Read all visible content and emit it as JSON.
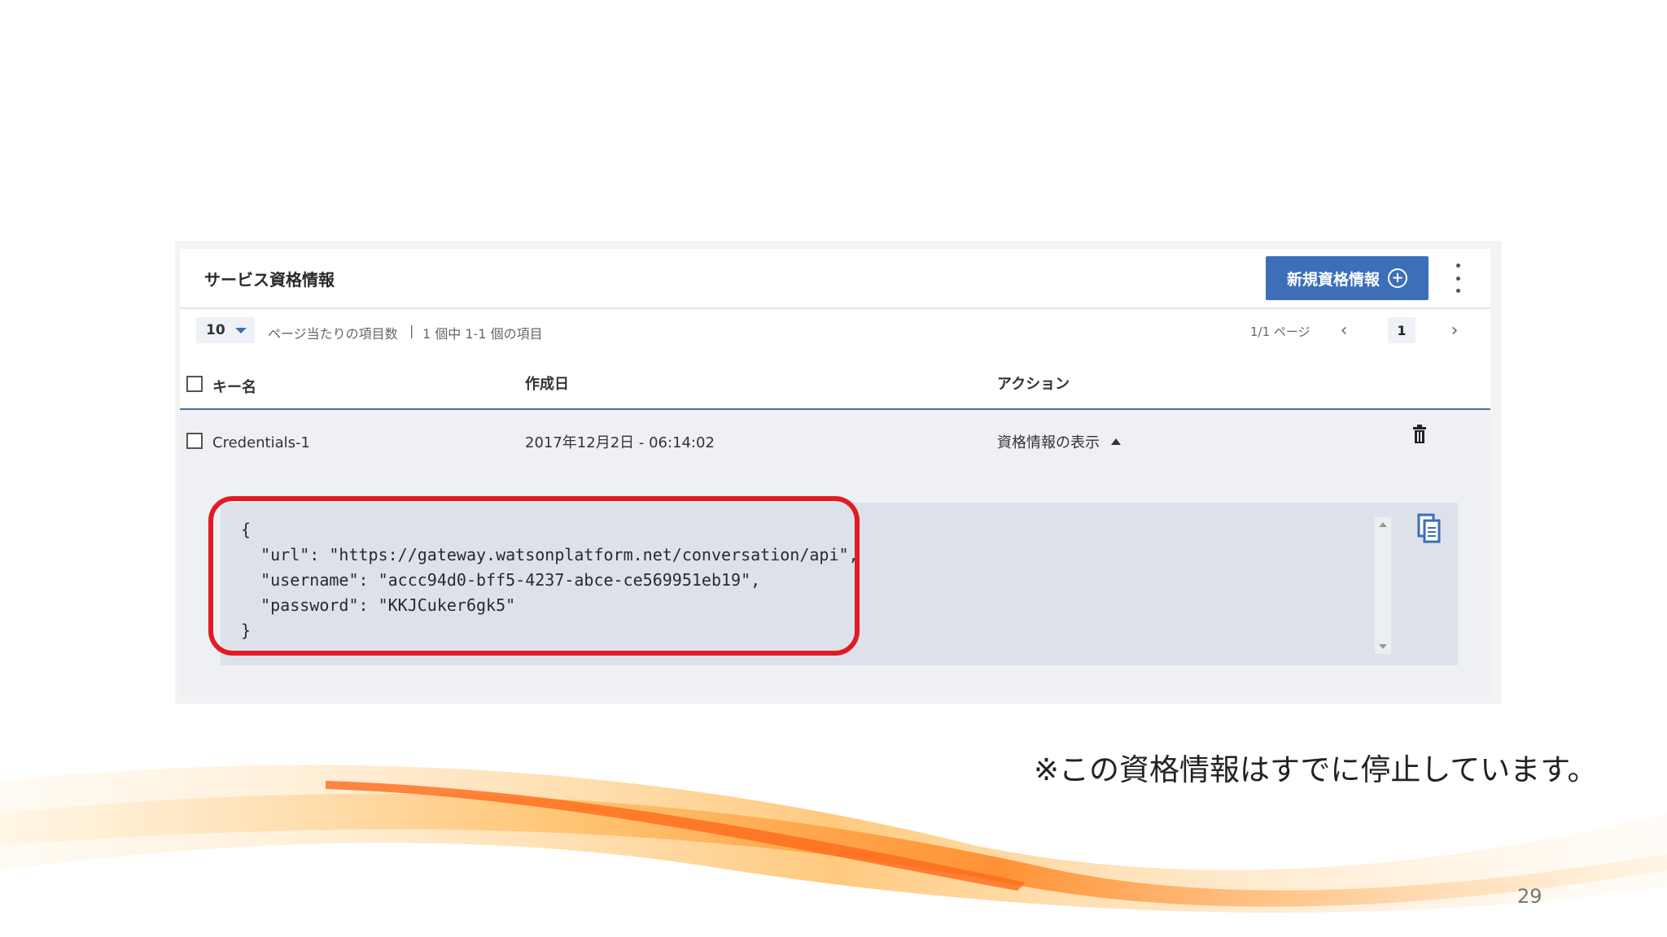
{
  "panel": {
    "title": "サービス資格情報",
    "new_button_label": "新規資格情報"
  },
  "pager": {
    "per_page": "10",
    "per_page_label": "ページ当たりの項目数",
    "separator": "|",
    "item_range": "1 個中 1-1 個の項目",
    "page_info": "1/1 ページ",
    "current_page": "1"
  },
  "table": {
    "headers": [
      "キー名",
      "作成日",
      "アクション"
    ],
    "rows": [
      {
        "key_name": "Credentials-1",
        "created": "2017年12月2日 - 06:14:02",
        "action": "資格情報の表示"
      }
    ]
  },
  "credentials_json": "{\n  \"url\": \"https://gateway.watsonplatform.net/conversation/api\",\n  \"username\": \"accc94d0-bff5-4237-abce-ce569951eb19\",\n  \"password\": \"KKJCuker6gk5\"\n}",
  "note": "※この資格情報はすでに停止しています。",
  "slide_number": "29",
  "colors": {
    "primary_button": "#3c6fb7",
    "highlight": "#e11a23",
    "credential_bg": "#dde2ea"
  }
}
